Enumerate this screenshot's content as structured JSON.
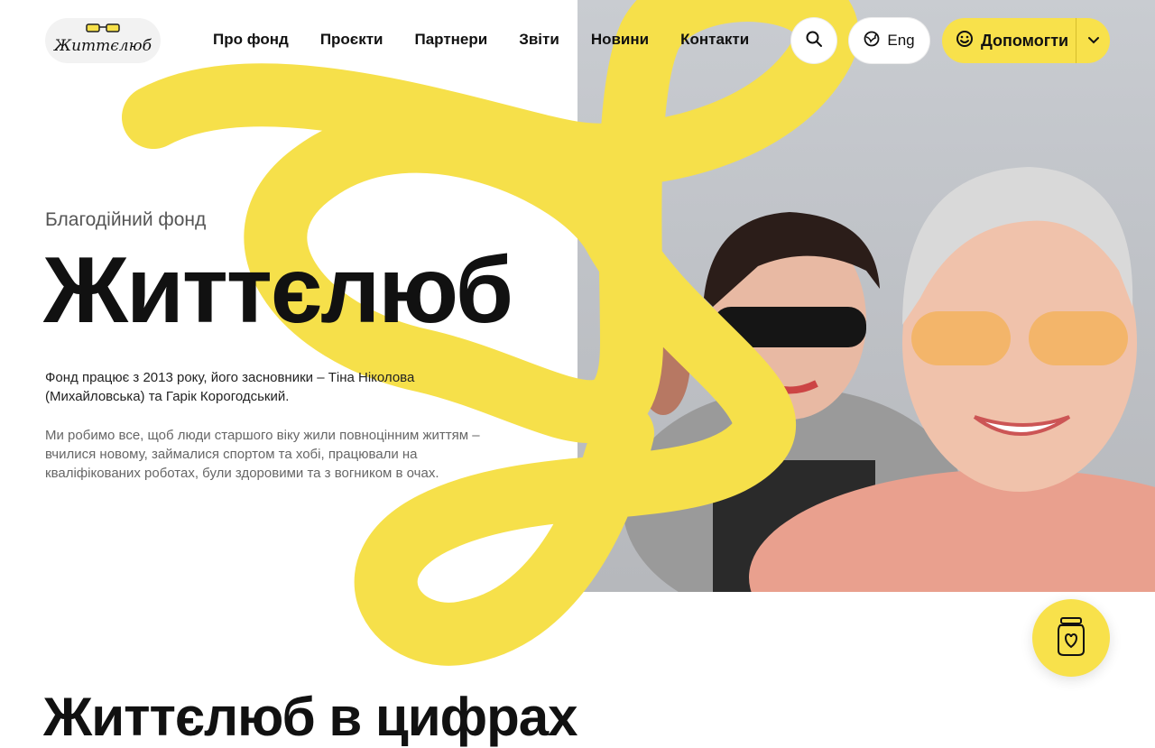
{
  "brand": {
    "logo_text": "Життєлюб",
    "logo_glyph": "glasses-icon"
  },
  "nav": {
    "items": [
      "Про фонд",
      "Проєкти",
      "Партнери",
      "Звіти",
      "Новини",
      "Контакти"
    ]
  },
  "header": {
    "search_icon": "search-icon",
    "lang_label": "Eng",
    "lang_icon": "globe-icon",
    "help_label": "Допомогти",
    "help_icon": "smile-icon",
    "help_dropdown_icon": "chevron-down-icon"
  },
  "hero": {
    "eyebrow": "Благодійний фонд",
    "title": "Життєлюб",
    "paragraph1": "Фонд працює з 2013 року, його засновники – Тіна Ніколова (Михайловська) та Гарік Корогодський.",
    "paragraph2": "Ми робимо все, щоб люди старшого віку жили повноцінним життям – вчилися новому, займалися спортом та хобі, працювали на кваліфікованих роботах, були здоровими та з вогником в очах."
  },
  "floating": {
    "jar_icon": "donation-jar-icon"
  },
  "stats": {
    "title": "Життєлюб в цифрах"
  },
  "colors": {
    "accent": "#f8e14b",
    "text": "#111111",
    "muted": "#666666"
  }
}
